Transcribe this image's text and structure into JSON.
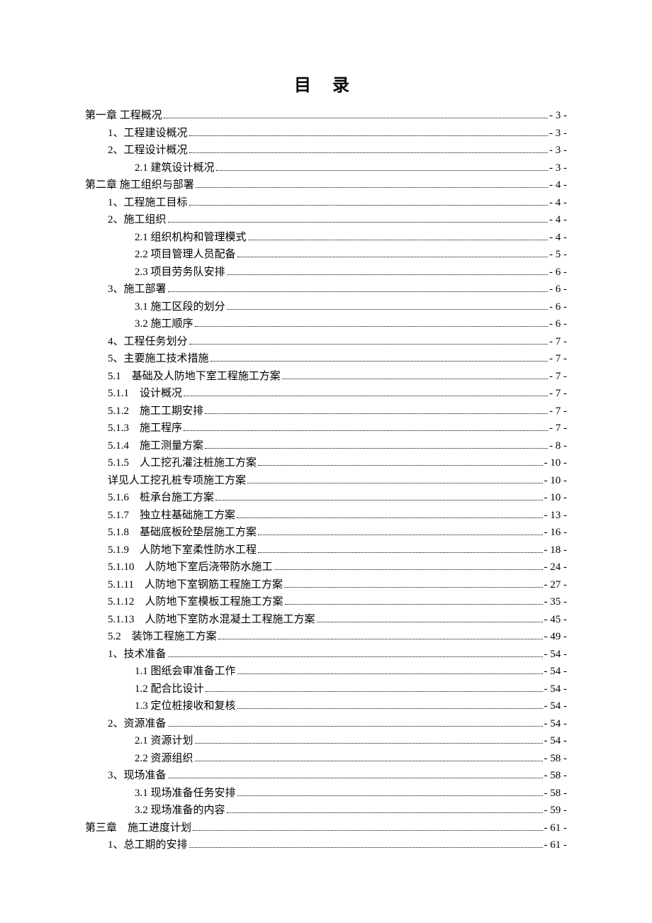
{
  "title": "目 录",
  "entries": [
    {
      "level": 0,
      "label": "第一章 工程概况",
      "page": "- 3 -"
    },
    {
      "level": 1,
      "label": "1、工程建设概况",
      "page": "- 3 -"
    },
    {
      "level": 1,
      "label": "2、工程设计概况",
      "page": "- 3 -"
    },
    {
      "level": 2,
      "label": "2.1 建筑设计概况",
      "page": "- 3 -"
    },
    {
      "level": 0,
      "label": "第二章 施工组织与部署",
      "page": "- 4 -"
    },
    {
      "level": 1,
      "label": "1、工程施工目标",
      "page": "- 4 -"
    },
    {
      "level": 1,
      "label": "2、施工组织",
      "page": "- 4 -"
    },
    {
      "level": 2,
      "label": "2.1 组织机构和管理模式",
      "page": "- 4 -"
    },
    {
      "level": 2,
      "label": "2.2 项目管理人员配备",
      "page": "- 5 -"
    },
    {
      "level": 2,
      "label": "2.3 项目劳务队安排",
      "page": "- 6 -"
    },
    {
      "level": 1,
      "label": "3、施工部署",
      "page": "- 6 -"
    },
    {
      "level": 2,
      "label": "3.1 施工区段的划分",
      "page": "- 6 -"
    },
    {
      "level": 2,
      "label": "3.2 施工顺序",
      "page": "- 6 -"
    },
    {
      "level": 1,
      "label": "4、工程任务划分",
      "page": "- 7 -"
    },
    {
      "level": 1,
      "label": "5、主要施工技术措施",
      "page": "- 7 -"
    },
    {
      "level": 1,
      "label": "5.1　基础及人防地下室工程施工方案",
      "page": "- 7 -"
    },
    {
      "level": 1,
      "label": "5.1.1　设计概况",
      "page": "- 7 -"
    },
    {
      "level": 1,
      "label": "5.1.2　施工工期安排",
      "page": "- 7 -"
    },
    {
      "level": 1,
      "label": "5.1.3　施工程序",
      "page": "- 7 -"
    },
    {
      "level": 1,
      "label": "5.1.4　施工测量方案",
      "page": "- 8 -"
    },
    {
      "level": 1,
      "label": "5.1.5　人工挖孔灌注桩施工方案",
      "page": "- 10 -"
    },
    {
      "level": 1,
      "label": "详见人工挖孔桩专项施工方案",
      "page": "- 10 -"
    },
    {
      "level": 1,
      "label": "5.1.6　桩承台施工方案",
      "page": "- 10 -"
    },
    {
      "level": 1,
      "label": "5.1.7　独立柱基础施工方案",
      "page": "- 13 -"
    },
    {
      "level": 1,
      "label": "5.1.8　基础底板砼垫层施工方案",
      "page": "- 16 -"
    },
    {
      "level": 1,
      "label": "5.1.9　人防地下室柔性防水工程",
      "page": "- 18 -"
    },
    {
      "level": 1,
      "label": "5.1.10　人防地下室后浇带防水施工",
      "page": "- 24 -"
    },
    {
      "level": 1,
      "label": "5.1.11　人防地下室钢筋工程施工方案",
      "page": "- 27 -"
    },
    {
      "level": 1,
      "label": "5.1.12　人防地下室模板工程施工方案",
      "page": "- 35 -"
    },
    {
      "level": 1,
      "label": "5.1.13　人防地下室防水混凝土工程施工方案",
      "page": "- 45 -"
    },
    {
      "level": 1,
      "label": "5.2　装饰工程施工方案",
      "page": "- 49 -"
    },
    {
      "level": 1,
      "label": "1、技术准备",
      "page": "- 54 -"
    },
    {
      "level": 2,
      "label": "1.1 图纸会审准备工作",
      "page": "- 54 -"
    },
    {
      "level": 2,
      "label": "1.2 配合比设计",
      "page": "- 54 -"
    },
    {
      "level": 2,
      "label": "1.3 定位桩接收和复核",
      "page": "- 54 -"
    },
    {
      "level": 1,
      "label": "2、资源准备",
      "page": "- 54 -"
    },
    {
      "level": 2,
      "label": "2.1 资源计划",
      "page": "- 54 -"
    },
    {
      "level": 2,
      "label": "2.2 资源组织",
      "page": "- 58 -"
    },
    {
      "level": 1,
      "label": "3、现场准备",
      "page": "- 58 -"
    },
    {
      "level": 2,
      "label": "3.1 现场准备任务安排",
      "page": "- 58 -"
    },
    {
      "level": 2,
      "label": "3.2 现场准备的内容",
      "page": "- 59 -"
    },
    {
      "level": 0,
      "label": "第三章　施工进度计划",
      "page": "- 61 -"
    },
    {
      "level": 1,
      "label": "1、总工期的安排",
      "page": "- 61 -"
    }
  ]
}
